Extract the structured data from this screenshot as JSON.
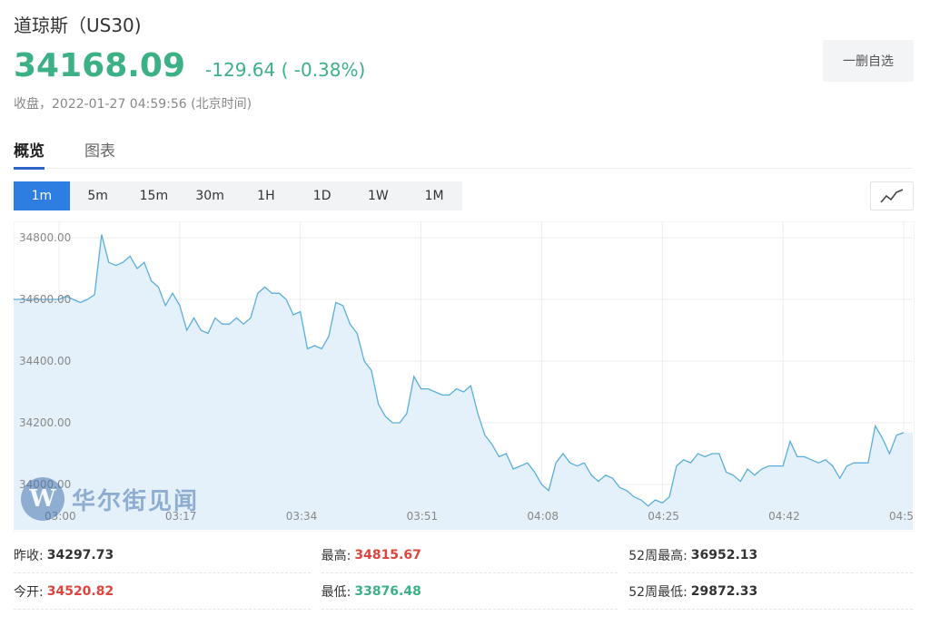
{
  "header": {
    "title": "道琼斯（US30)",
    "price": "34168.09",
    "change": "-129.64 ( -0.38%)",
    "status_prefix": "收盘，",
    "timestamp": "2022-01-27 04:59:56",
    "timezone": "(北京时间)",
    "watch_button": "一删自选"
  },
  "tabs": [
    {
      "label": "概览",
      "active": true
    },
    {
      "label": "图表",
      "active": false
    }
  ],
  "periods": [
    {
      "label": "1m",
      "active": true
    },
    {
      "label": "5m",
      "active": false
    },
    {
      "label": "15m",
      "active": false
    },
    {
      "label": "30m",
      "active": false
    },
    {
      "label": "1H",
      "active": false
    },
    {
      "label": "1D",
      "active": false
    },
    {
      "label": "1W",
      "active": false
    },
    {
      "label": "1M",
      "active": false
    }
  ],
  "watermark": {
    "logo_letter": "W",
    "text": "华尔街见闻"
  },
  "colors": {
    "up": "#e0433d",
    "down": "#3cb185",
    "line": "#5aaedc",
    "fill": "#e4f1fb",
    "active_period": "#2e7de1"
  },
  "chart_data": {
    "type": "area",
    "ylim": [
      33950,
      34850
    ],
    "yticks": [
      34000,
      34200,
      34400,
      34600,
      34800
    ],
    "ytick_labels": [
      "34000.00",
      "34200.00",
      "34400.00",
      "34600.00",
      "34800.00"
    ],
    "xticks": [
      0,
      17,
      34,
      51,
      68,
      85,
      102,
      119
    ],
    "xtick_labels": [
      "03:00",
      "03:17",
      "03:34",
      "03:51",
      "04:08",
      "04:25",
      "04:42",
      "04:5"
    ],
    "xlim": [
      0,
      119
    ],
    "x": [
      0,
      1,
      2,
      3,
      4,
      5,
      6,
      7,
      8,
      9,
      10,
      11,
      12,
      13,
      14,
      15,
      16,
      17,
      18,
      19,
      20,
      21,
      22,
      23,
      24,
      25,
      26,
      27,
      28,
      29,
      30,
      31,
      32,
      33,
      34,
      35,
      36,
      37,
      38,
      39,
      40,
      41,
      42,
      43,
      44,
      45,
      46,
      47,
      48,
      49,
      50,
      51,
      52,
      53,
      54,
      55,
      56,
      57,
      58,
      59,
      60,
      61,
      62,
      63,
      64,
      65,
      66,
      67,
      68,
      69,
      70,
      71,
      72,
      73,
      74,
      75,
      76,
      77,
      78,
      79,
      80,
      81,
      82,
      83,
      84,
      85,
      86,
      87,
      88,
      89,
      90,
      91,
      92,
      93,
      94,
      95,
      96,
      97,
      98,
      99,
      100,
      101,
      102,
      103,
      104,
      105,
      106,
      107,
      108,
      109,
      110,
      111,
      112,
      113,
      114,
      115,
      116,
      117,
      118,
      119
    ],
    "y": [
      34600,
      34610,
      34600,
      34590,
      34600,
      34615,
      34810,
      34720,
      34710,
      34720,
      34740,
      34700,
      34720,
      34660,
      34640,
      34580,
      34620,
      34580,
      34500,
      34540,
      34500,
      34490,
      34540,
      34520,
      34520,
      34540,
      34520,
      34540,
      34620,
      34640,
      34620,
      34620,
      34600,
      34550,
      34560,
      34440,
      34450,
      34440,
      34480,
      34590,
      34580,
      34520,
      34490,
      34400,
      34370,
      34260,
      34220,
      34200,
      34200,
      34230,
      34350,
      34310,
      34310,
      34300,
      34290,
      34290,
      34310,
      34300,
      34320,
      34230,
      34160,
      34130,
      34090,
      34100,
      34050,
      34060,
      34070,
      34040,
      34000,
      33980,
      34070,
      34100,
      34070,
      34060,
      34070,
      34030,
      34010,
      34030,
      34020,
      33990,
      33980,
      33960,
      33950,
      33930,
      33950,
      33940,
      33960,
      34060,
      34080,
      34070,
      34100,
      34090,
      34100,
      34100,
      34040,
      34030,
      34010,
      34050,
      34030,
      34050,
      34060,
      34060,
      34060,
      34140,
      34090,
      34090,
      34080,
      34070,
      34080,
      34060,
      34020,
      34060,
      34070,
      34070,
      34070,
      34190,
      34150,
      34100,
      34160,
      34168
    ]
  },
  "stats": [
    [
      {
        "label": "昨收:",
        "value": "34297.73",
        "tone": "neutral"
      },
      {
        "label": "最高:",
        "value": "34815.67",
        "tone": "up"
      },
      {
        "label": "52周最高:",
        "value": "36952.13",
        "tone": "neutral"
      }
    ],
    [
      {
        "label": "今开:",
        "value": "34520.82",
        "tone": "up"
      },
      {
        "label": "最低:",
        "value": "33876.48",
        "tone": "down"
      },
      {
        "label": "52周最低:",
        "value": "29872.33",
        "tone": "neutral"
      }
    ]
  ]
}
